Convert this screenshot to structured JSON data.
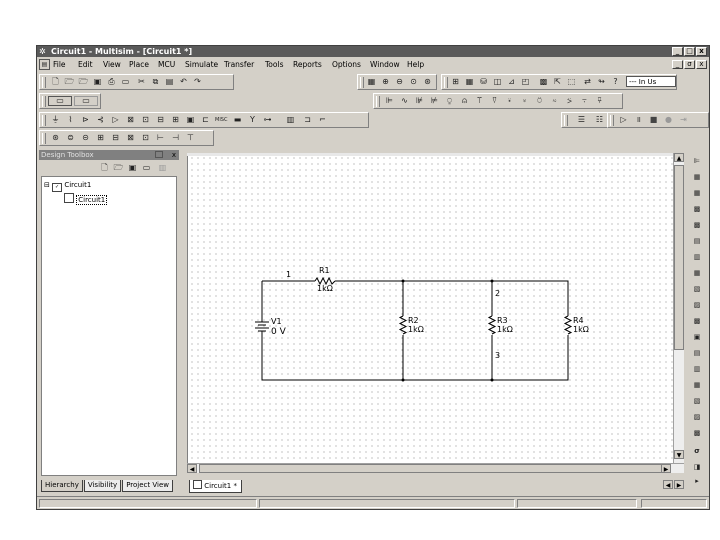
{
  "window": {
    "title": "Circuit1 - Multisim - [Circuit1 *]",
    "app_icon": "multisim-icon",
    "controls": [
      "_",
      "□",
      "x"
    ],
    "mdi_controls": [
      "_",
      "σ",
      "x"
    ]
  },
  "menu": {
    "items": [
      "File",
      "Edit",
      "View",
      "Place",
      "MCU",
      "Simulate",
      "Transfer",
      "Tools",
      "Reports",
      "Options",
      "Window",
      "Help"
    ]
  },
  "toolbar": {
    "in_use_label": "--- In Us"
  },
  "design_toolbox": {
    "title": "Design Toolbox",
    "close": "x",
    "tree": {
      "root": "Circuit1",
      "child": "Circuit1",
      "expander": "⊟"
    },
    "tabs": [
      "Hierarchy",
      "Visibility",
      "Project View"
    ]
  },
  "document_tab": {
    "label": "Circuit1",
    "suffix": "*"
  },
  "schematic": {
    "nodes": {
      "n1": "1",
      "n2": "2",
      "n3": "3"
    },
    "components": [
      {
        "ref": "R1",
        "value": "1kΩ",
        "kind": "resistor"
      },
      {
        "ref": "V1",
        "value": "0 V",
        "kind": "battery"
      },
      {
        "ref": "R2",
        "value": "1kΩ",
        "kind": "resistor"
      },
      {
        "ref": "R3",
        "value": "1kΩ",
        "kind": "resistor"
      },
      {
        "ref": "R4",
        "value": "1kΩ",
        "kind": "resistor"
      }
    ]
  },
  "colors": {
    "titlebar": "#5a5a5a",
    "chrome": "#d4d0c8",
    "wire": "#000000"
  }
}
